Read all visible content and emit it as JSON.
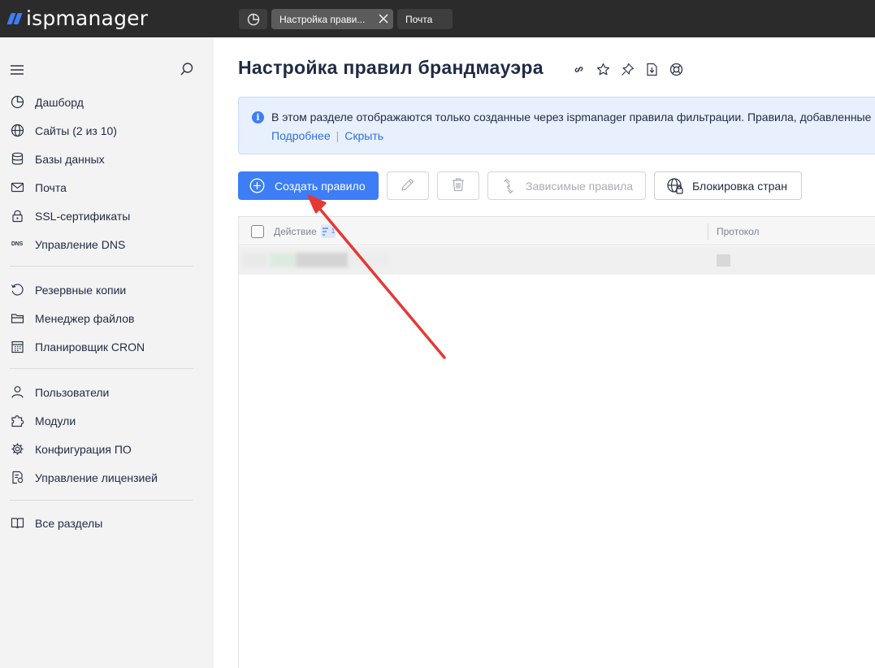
{
  "app": {
    "logo_text": "ispmanager",
    "brand_color": "#3d7df6"
  },
  "tabs": [
    {
      "label": "Настройка прави...",
      "active": true
    },
    {
      "label": "Почта",
      "active": false
    }
  ],
  "sidebar": {
    "items": [
      {
        "label": "Дашборд",
        "icon": "dashboard-icon"
      },
      {
        "label": "Сайты (2 из 10)",
        "icon": "globe-icon"
      },
      {
        "label": "Базы данных",
        "icon": "database-icon"
      },
      {
        "label": "Почта",
        "icon": "mail-icon"
      },
      {
        "label": "SSL-сертификаты",
        "icon": "lock-icon"
      },
      {
        "label": "Управление DNS",
        "icon": "dns-icon"
      },
      {
        "label": "Резервные копии",
        "icon": "backup-icon"
      },
      {
        "label": "Менеджер файлов",
        "icon": "folder-icon"
      },
      {
        "label": "Планировщик CRON",
        "icon": "calendar-icon"
      },
      {
        "label": "Пользователи",
        "icon": "user-icon"
      },
      {
        "label": "Модули",
        "icon": "puzzle-icon"
      },
      {
        "label": "Конфигурация ПО",
        "icon": "gear-icon"
      },
      {
        "label": "Управление лицензией",
        "icon": "license-icon"
      },
      {
        "label": "Все разделы",
        "icon": "book-icon"
      }
    ],
    "dns_icon_text": "DNS"
  },
  "main": {
    "title": "Настройка правил брандмауэра",
    "info": {
      "text": "В этом разделе отображаются только созданные через ispmanager правила фильтрации. Правила, добавленные",
      "more_link": "Подробнее",
      "separator": "|",
      "hide_link": "Скрыть",
      "icon_glyph": "i"
    },
    "toolbar": {
      "create_label": "Создать правило",
      "dependent_label": "Зависимые правила",
      "geo_block_label": "Блокировка стран"
    },
    "table": {
      "columns": [
        "Действие",
        "Протокол"
      ],
      "sort_index": "1"
    }
  },
  "annotation": {
    "arrow_color": "#e53935"
  }
}
